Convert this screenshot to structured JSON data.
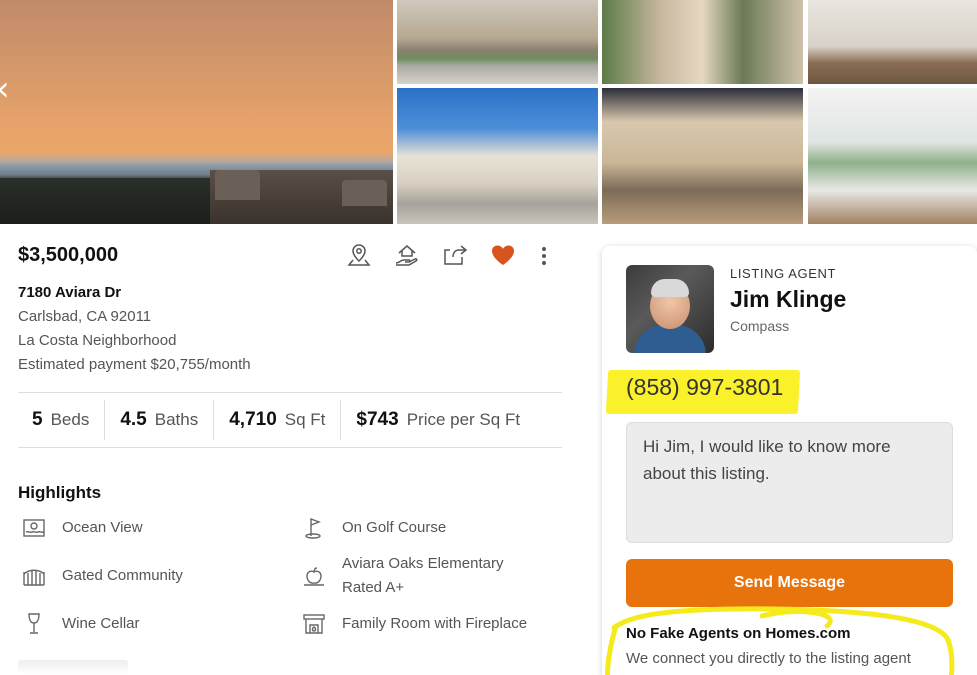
{
  "gallery": {
    "prev_arrow": "‹",
    "photo_count": 7
  },
  "listing": {
    "price": "$3,500,000",
    "address": "7180 Aviara Dr",
    "city_state_zip": "Carlsbad, CA 92011",
    "neighborhood": "La Costa Neighborhood",
    "estimated_payment": "Estimated payment $20,755/month",
    "actions": [
      "map-pin-icon",
      "home-hand-icon",
      "share-icon",
      "heart-icon",
      "more-vertical-icon"
    ],
    "favorite_color": "#d9531e"
  },
  "stats": [
    {
      "value": "5",
      "label": "Beds"
    },
    {
      "value": "4.5",
      "label": "Baths"
    },
    {
      "value": "4,710",
      "label": "Sq Ft"
    },
    {
      "value": "$743",
      "label": "Price per Sq Ft"
    }
  ],
  "highlights": {
    "title": "Highlights",
    "items": [
      {
        "label": "Ocean View",
        "icon": "ocean-view-icon"
      },
      {
        "label": "On Golf Course",
        "icon": "golf-flag-icon"
      },
      {
        "label": "Gated Community",
        "icon": "gate-icon"
      },
      {
        "label": "Aviara Oaks Elementary Rated A+",
        "line1": "Aviara Oaks Elementary",
        "line2": "Rated A+",
        "icon": "school-apple-icon"
      },
      {
        "label": "Wine Cellar",
        "icon": "wine-glass-icon"
      },
      {
        "label": "Family Room with Fireplace",
        "icon": "fireplace-icon"
      }
    ]
  },
  "agent": {
    "label": "LISTING AGENT",
    "name": "Jim Klinge",
    "company": "Compass",
    "phone": "(858) 997-3801",
    "message": "Hi Jim, I would like to know more about this listing.",
    "send_label": "Send Message",
    "no_fake_title": "No Fake Agents on Homes.com",
    "no_fake_text": "We connect you directly to the listing agent"
  },
  "colors": {
    "accent": "#e8720c",
    "highlight": "#fbf12a"
  }
}
